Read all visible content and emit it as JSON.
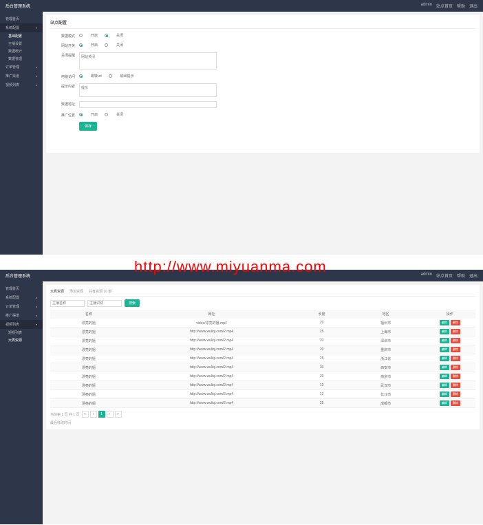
{
  "watermark": "http://www.miyuanma.com",
  "header": {
    "title": "后台管理系统",
    "user": "admin",
    "links": [
      "站点首页",
      "帮助",
      "退出"
    ]
  },
  "sidebar1": {
    "items": [
      {
        "label": "管理首页",
        "hasArrow": false
      },
      {
        "label": "系统配置",
        "hasArrow": true,
        "active": true,
        "subs": [
          {
            "label": "基础配置",
            "active": true
          },
          {
            "label": "主播设置"
          },
          {
            "label": "数据统计"
          },
          {
            "label": "数据管理"
          }
        ]
      },
      {
        "label": "订单管理",
        "hasArrow": true
      },
      {
        "label": "推广渠道",
        "hasArrow": true
      },
      {
        "label": "视频列表",
        "hasArrow": true
      }
    ]
  },
  "sidebar2": {
    "items": [
      {
        "label": "管理首页",
        "hasArrow": false
      },
      {
        "label": "系统配置",
        "hasArrow": true
      },
      {
        "label": "订单管理",
        "hasArrow": true
      },
      {
        "label": "推广渠道",
        "hasArrow": true
      },
      {
        "label": "视频列表",
        "hasArrow": true,
        "active": true,
        "subs": [
          {
            "label": "短视列表"
          },
          {
            "label": "大秀资源",
            "active": true
          }
        ]
      }
    ]
  },
  "panel1": {
    "title": "站点配置",
    "form": {
      "dataStatus": {
        "label": "数据模式",
        "opts": [
          "开启",
          "关闭"
        ],
        "checked": 1
      },
      "siteSwitch": {
        "label": "网站开关",
        "opts": [
          "开启",
          "关闭"
        ],
        "checked": 0
      },
      "closeTitle": {
        "label": "关闭提醒",
        "placeholder": "网站关闭"
      },
      "computerVisit": {
        "label": "电脑访问",
        "opts": [
          "跳转url",
          "输出提示"
        ],
        "checked": 0
      },
      "jumpContent": {
        "label": "提示内容",
        "placeholder": "提示"
      },
      "dataAddr": {
        "label": "数据地址",
        "placeholder": ""
      },
      "promoPos": {
        "label": "推广位置",
        "opts": [
          "开启",
          "关闭"
        ],
        "checked": 0
      },
      "saveBtn": "保存"
    }
  },
  "panel2": {
    "tabs": [
      "大秀资源",
      "添加资源",
      "共有资源 10 部"
    ],
    "activeTab": 0,
    "search": {
      "namePlaceholder": "主播名称",
      "blurPlaceholder": "主播识别",
      "btn": "搜索"
    },
    "table": {
      "headers": [
        "名称",
        "网址",
        "长度",
        "地区",
        "操作"
      ],
      "rows": [
        {
          "name": "漂亮的姐",
          "url": "video/漂亮的姐.mp4",
          "len": "20",
          "region": "福州市"
        },
        {
          "name": "漂亮的姐",
          "url": "http://www.wuliqi.com/2.mp4",
          "len": "25",
          "region": "上海市"
        },
        {
          "name": "漂亮的姐",
          "url": "http://www.wuliqi.com/2.mp4",
          "len": "20",
          "region": "深圳市"
        },
        {
          "name": "漂亮的姐",
          "url": "http://www.wuliqi.com/2.mp4",
          "len": "20",
          "region": "重庆市"
        },
        {
          "name": "漂亮的姐",
          "url": "http://www.wuliqi.com/2.mp4",
          "len": "25",
          "region": "浙江省"
        },
        {
          "name": "漂亮的姐",
          "url": "http://www.wuliqi.com/2.mp4",
          "len": "30",
          "region": "西安市"
        },
        {
          "name": "漂亮的姐",
          "url": "http://www.wuliqi.com/2.mp4",
          "len": "20",
          "region": "南京市"
        },
        {
          "name": "漂亮的姐",
          "url": "http://www.wuliqi.com/2.mp4",
          "len": "10",
          "region": "武汉市"
        },
        {
          "name": "漂亮的姐",
          "url": "http://www.wuliqi.com/2.mp4",
          "len": "12",
          "region": "长沙市"
        },
        {
          "name": "漂亮的姐",
          "url": "http://www.wuliqi.com/2.mp4",
          "len": "25",
          "region": "成都市"
        }
      ],
      "actions": [
        "编辑",
        "删除"
      ]
    },
    "pagination": {
      "info": "当前第 1 页 共 1 页",
      "pages": [
        "«",
        "‹",
        "1",
        "›",
        "»"
      ],
      "activePage": 2
    },
    "footer": "最后修改时间"
  }
}
